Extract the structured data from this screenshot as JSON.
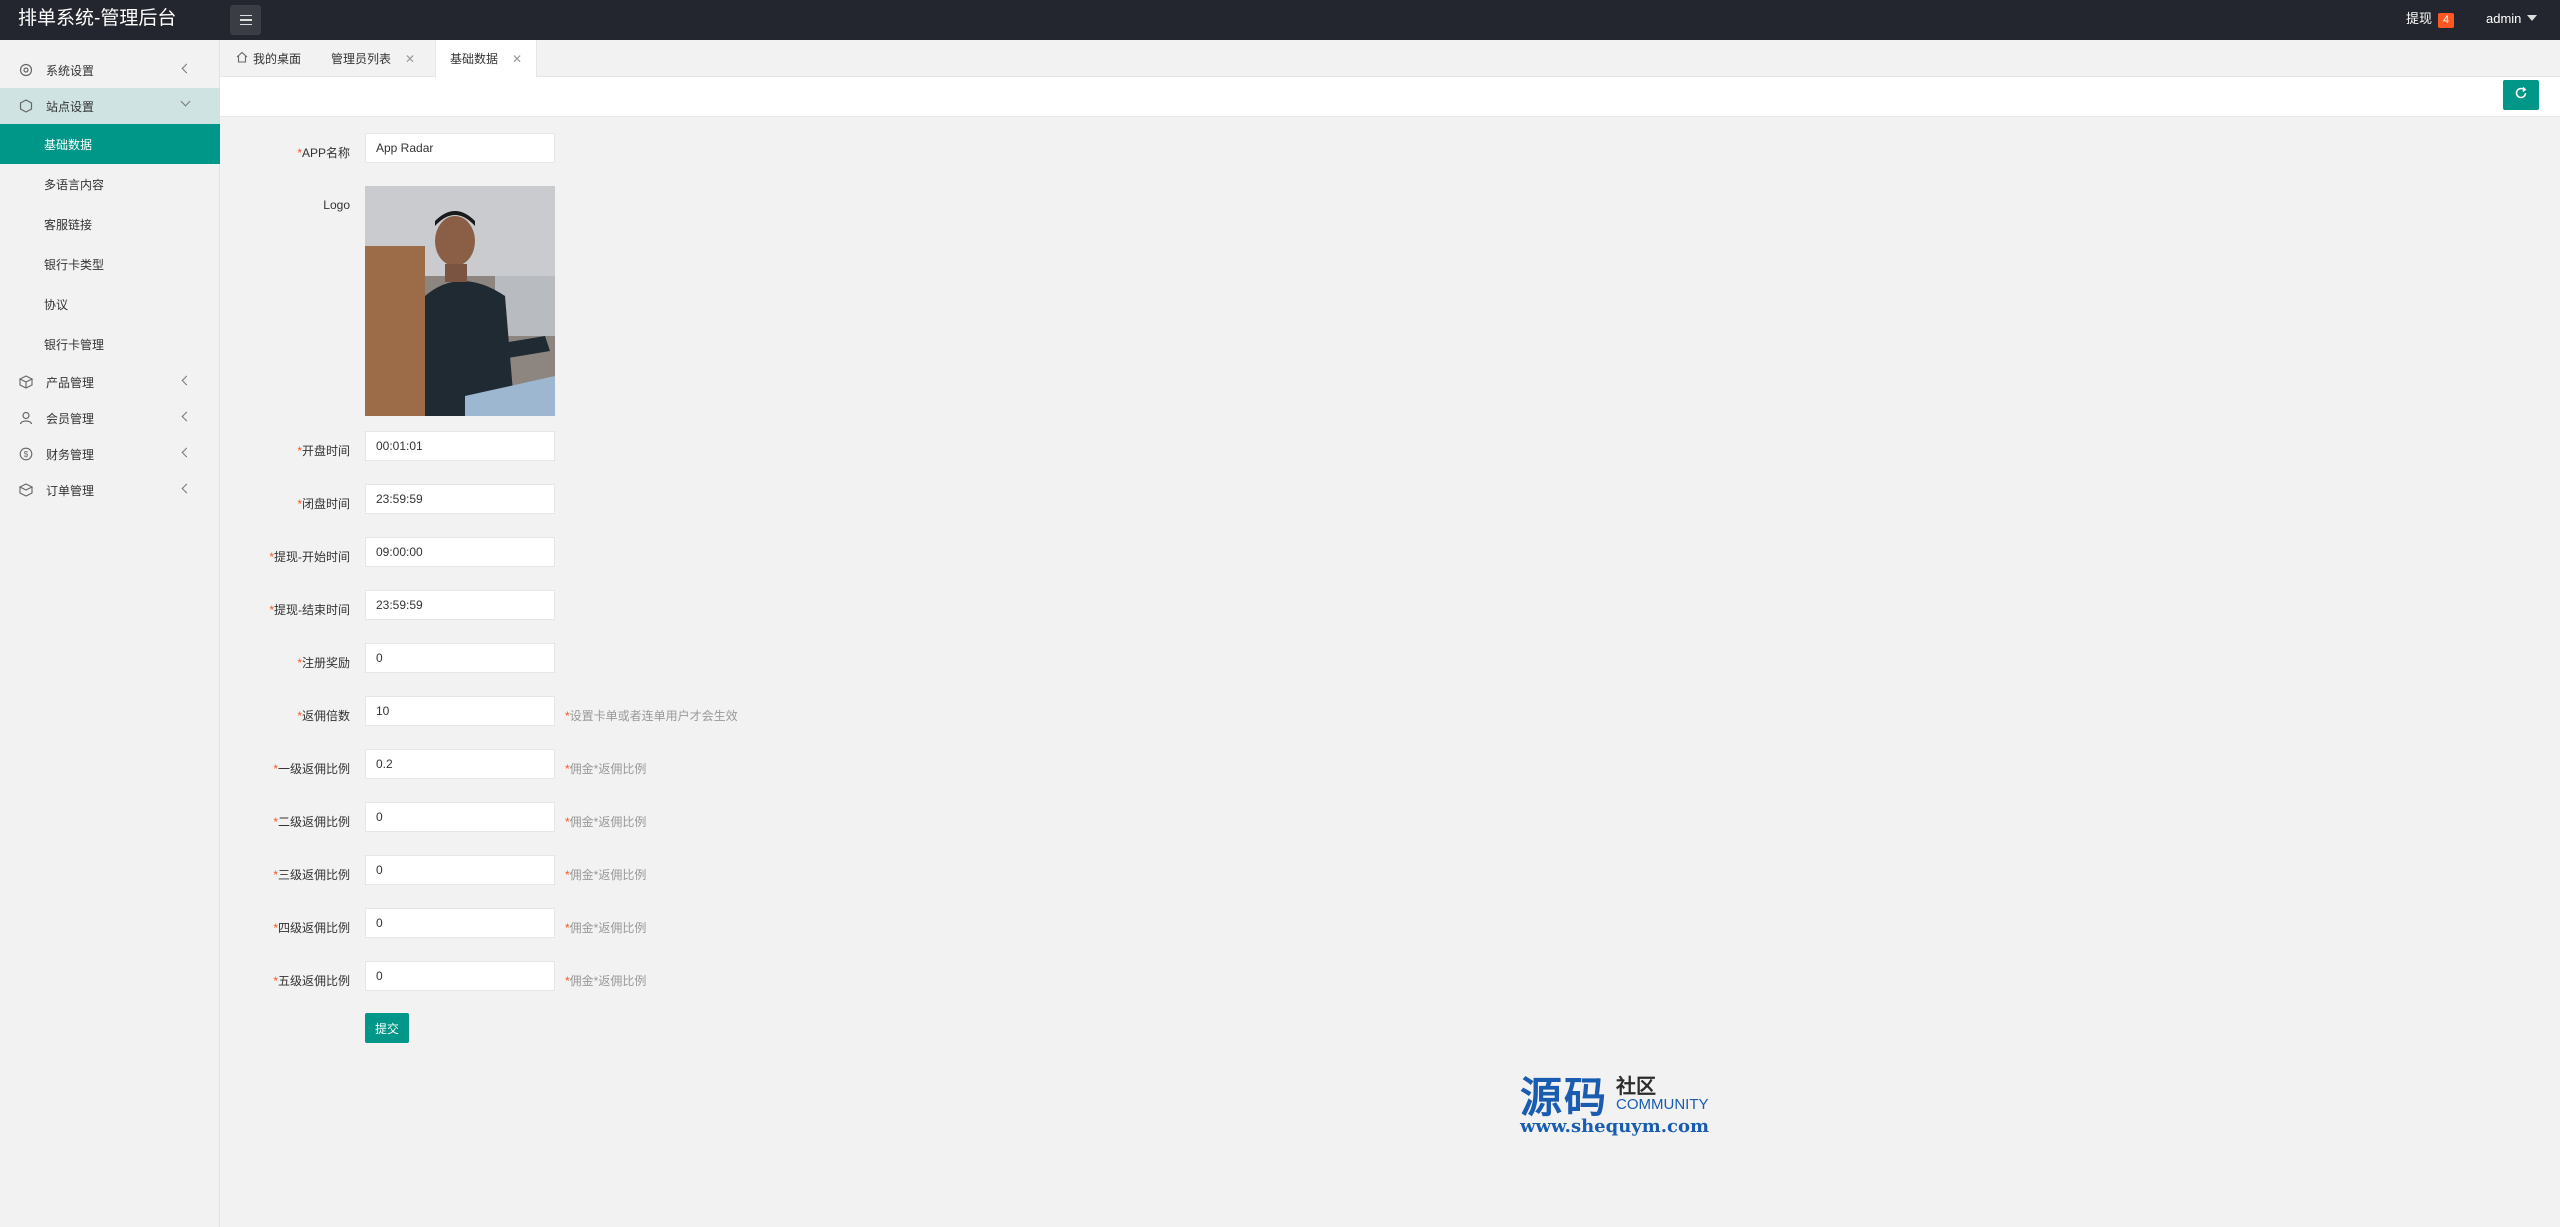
{
  "header": {
    "brand": "排单系统-管理后台",
    "withdraw_label": "提现",
    "withdraw_count": "4",
    "user_name": "admin"
  },
  "sidebar": {
    "items": [
      {
        "label": "系统设置",
        "icon": "gear-icon"
      },
      {
        "label": "站点设置",
        "icon": "site-icon"
      },
      {
        "label": "产品管理",
        "icon": "product-icon"
      },
      {
        "label": "会员管理",
        "icon": "user-icon"
      },
      {
        "label": "财务管理",
        "icon": "finance-icon"
      },
      {
        "label": "订单管理",
        "icon": "order-icon"
      }
    ],
    "sub_items": [
      "基础数据",
      "多语言内容",
      "客服链接",
      "银行卡类型",
      "协议",
      "银行卡管理"
    ]
  },
  "tabs": [
    {
      "label": "我的桌面"
    },
    {
      "label": "管理员列表"
    },
    {
      "label": "基础数据"
    }
  ],
  "form": {
    "app_name": {
      "label": "APP名称",
      "value": "App Radar"
    },
    "logo": {
      "label": "Logo"
    },
    "open_time": {
      "label": "开盘时间",
      "value": "00:01:01"
    },
    "close_time": {
      "label": "闭盘时间",
      "value": "23:59:59"
    },
    "withdraw_start": {
      "label": "提现-开始时间",
      "value": "09:00:00"
    },
    "withdraw_end": {
      "label": "提现-结束时间",
      "value": "23:59:59"
    },
    "register_reward": {
      "label": "注册奖励",
      "value": "0"
    },
    "commission_multiple": {
      "label": "返佣倍数",
      "value": "10",
      "hint": "设置卡单或者连单用户才会生效"
    },
    "level1": {
      "label": "一级返佣比例",
      "value": "0.2",
      "hint": "佣金*返佣比例"
    },
    "level2": {
      "label": "二级返佣比例",
      "value": "0",
      "hint": "佣金*返佣比例"
    },
    "level3": {
      "label": "三级返佣比例",
      "value": "0",
      "hint": "佣金*返佣比例"
    },
    "level4": {
      "label": "四级返佣比例",
      "value": "0",
      "hint": "佣金*返佣比例"
    },
    "level5": {
      "label": "五级返佣比例",
      "value": "0",
      "hint": "佣金*返佣比例"
    },
    "submit_label": "提交"
  },
  "watermark": {
    "big": "源码",
    "small": "社区",
    "english": "COMMUNITY",
    "url": "www.shequym.com"
  },
  "colors": {
    "accent": "#009688",
    "header_bg": "#23262e",
    "badge": "#ff5722"
  }
}
